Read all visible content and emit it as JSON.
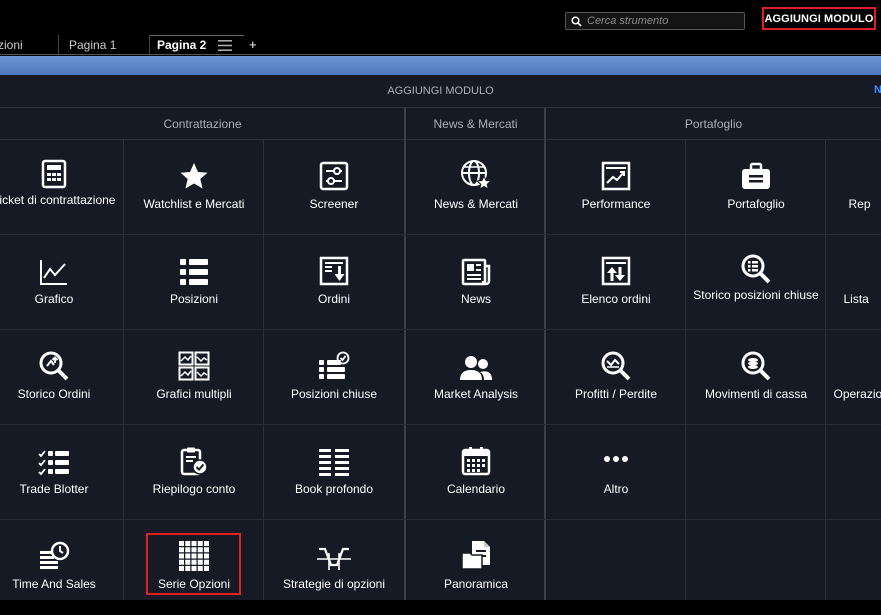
{
  "header": {
    "search_placeholder": "Cerca strumento",
    "add_module_button": "AGGIUNGI MODULO"
  },
  "tabs": [
    {
      "label": "zioni"
    },
    {
      "label": "Pagina 1"
    },
    {
      "label": "Pagina 2"
    },
    {
      "label": "+"
    }
  ],
  "panel": {
    "title": "AGGIUNGI MODULO",
    "next_label": "N",
    "sections": {
      "trading": "Contrattazione",
      "news": "News & Mercati",
      "portfolio": "Portafoglio"
    }
  },
  "modules": {
    "ticket": "Ticket di contrattazione",
    "watchlist": "Watchlist e Mercati",
    "screener": "Screener",
    "news_markets": "News & Mercati",
    "performance": "Performance",
    "portafoglio": "Portafoglio",
    "rep": "Rep",
    "grafico": "Grafico",
    "posizioni": "Posizioni",
    "ordini": "Ordini",
    "news": "News",
    "elenco_ordini": "Elenco ordini",
    "storico_posizioni": "Storico posizioni chiuse",
    "lista": "Lista",
    "storico_ordini": "Storico Ordini",
    "grafici_multipli": "Grafici multipli",
    "posizioni_chiuse": "Posizioni chiuse",
    "market_analysis": "Market Analysis",
    "profitti": "Profitti / Perdite",
    "movimenti": "Movimenti di cassa",
    "operazioni": "Operazio",
    "trade_blotter": "Trade Blotter",
    "riepilogo": "Riepilogo conto",
    "book": "Book profondo",
    "calendario": "Calendario",
    "altro": "Altro",
    "time_sales": "Time And Sales",
    "serie_opzioni": "Serie Opzioni",
    "strategie": "Strategie di opzioni",
    "panoramica": "Panoramica"
  },
  "colors": {
    "highlight": "#e02020",
    "panel_bg": "#151a24",
    "accent_blue": "#4a8cff"
  }
}
